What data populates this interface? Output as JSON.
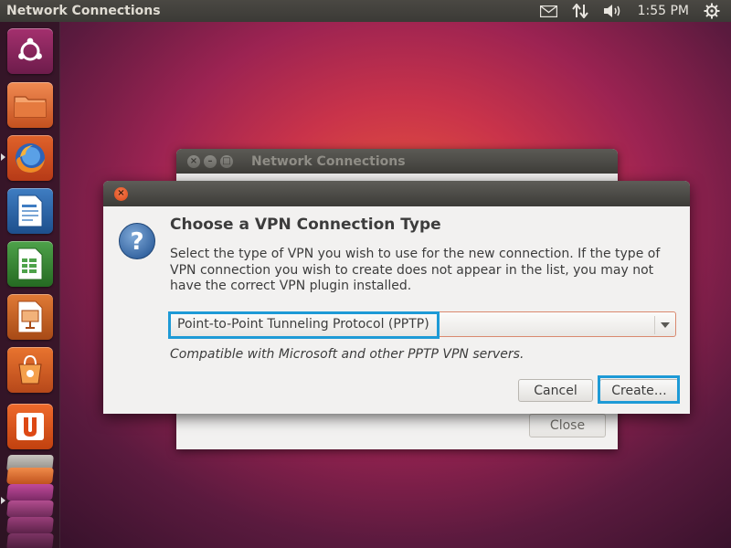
{
  "top_panel": {
    "app_title": "Network Connections",
    "clock": "1:55 PM",
    "indicators": [
      "mail-icon",
      "network-arrows-icon",
      "volume-icon",
      "gear-icon"
    ]
  },
  "launcher": {
    "items": [
      "dash-home",
      "files",
      "firefox",
      "writer",
      "calc",
      "impress",
      "software-center",
      "ubuntu-one",
      "workspaces"
    ]
  },
  "background_window": {
    "title": "Network Connections",
    "close_label": "Close"
  },
  "dialog": {
    "heading": "Choose a VPN Connection Type",
    "description": "Select the type of VPN you wish to use for the new connection.  If the type of VPN connection you wish to create does not appear in the list, you may not have the correct VPN plugin installed.",
    "selected_type": "Point-to-Point Tunneling Protocol (PPTP)",
    "note": "Compatible with Microsoft and other PPTP VPN servers.",
    "cancel_label": "Cancel",
    "create_label": "Create…"
  },
  "colors": {
    "highlight": "#1e9ad6",
    "panel": "#3b3a36",
    "dialog_bg": "#f2f1f0"
  }
}
